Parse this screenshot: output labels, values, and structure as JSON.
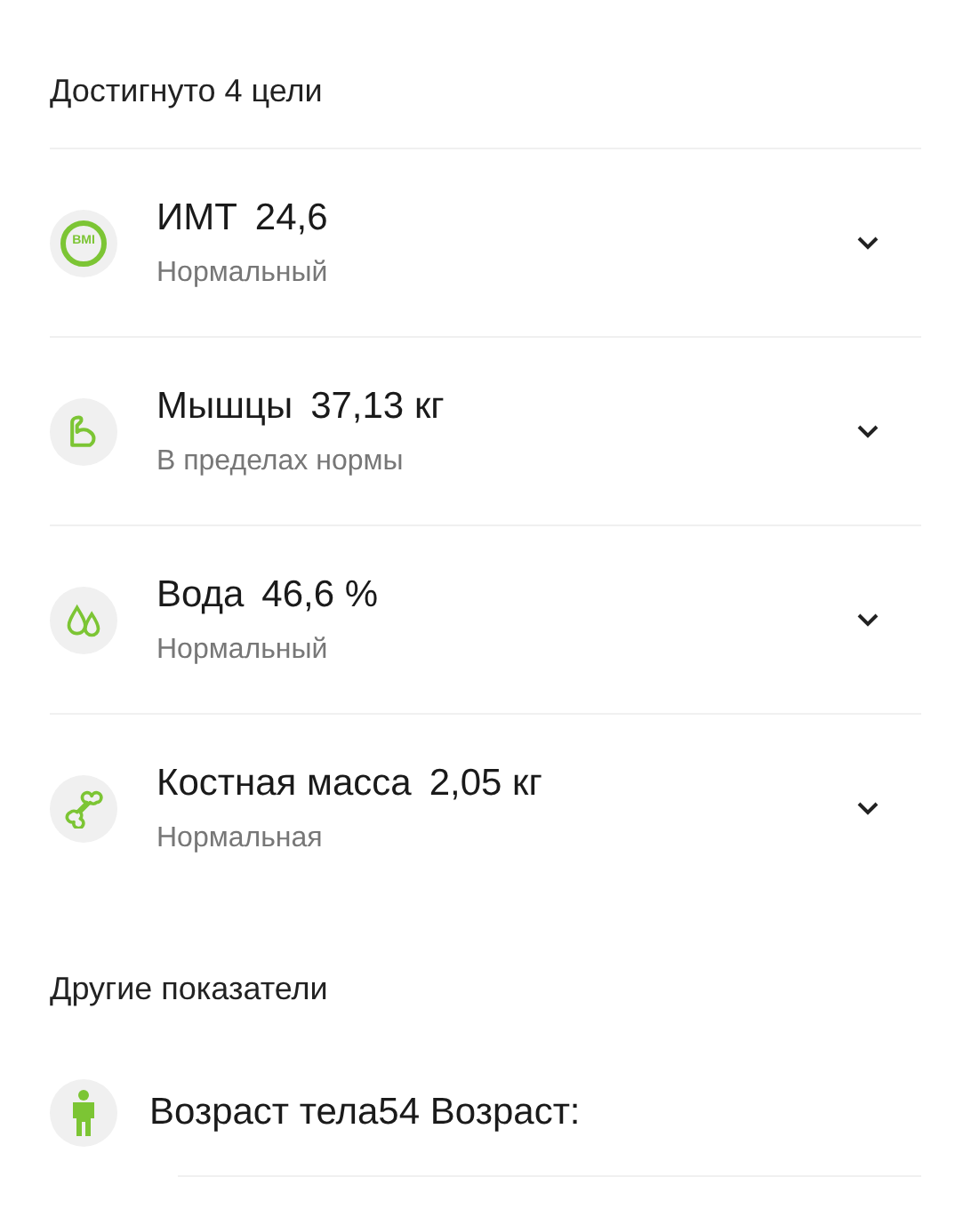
{
  "goals_heading": "Достигнуто 4 цели",
  "goals": [
    {
      "kind": "bmi",
      "icon_label": "BMI",
      "name": "ИМТ",
      "value": "24,6",
      "status": "Нормальный",
      "expanded": false
    },
    {
      "kind": "muscle",
      "name": "Мышцы",
      "value": "37,13 кг",
      "status": "В пределах нормы",
      "expanded": false
    },
    {
      "kind": "water",
      "name": "Вода",
      "value": "46,6 %",
      "status": "Нормальный",
      "expanded": false
    },
    {
      "kind": "bone",
      "name": "Костная масса",
      "value": "2,05 кг",
      "status": "Нормальная",
      "expanded": false
    }
  ],
  "other_heading": "Другие показатели",
  "other": [
    {
      "kind": "person",
      "text": "Возраст тела54 Возраст:"
    }
  ]
}
